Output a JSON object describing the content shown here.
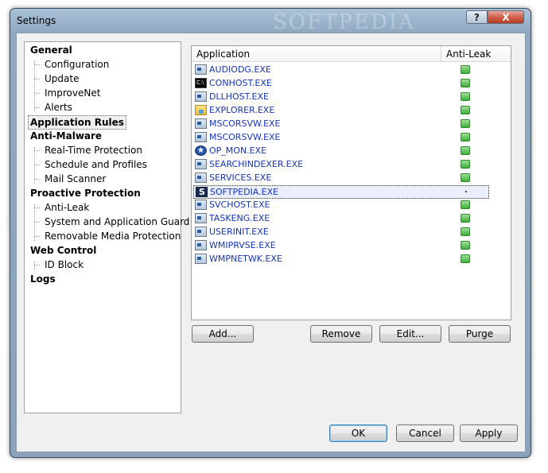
{
  "window": {
    "title": "Settings",
    "help_label": "?",
    "close_label": "X",
    "watermark": "SOFTPEDIA"
  },
  "tree": {
    "items": [
      {
        "label": "General",
        "level": 0
      },
      {
        "label": "Configuration",
        "level": 1
      },
      {
        "label": "Update",
        "level": 1
      },
      {
        "label": "ImproveNet",
        "level": 1
      },
      {
        "label": "Alerts",
        "level": 1
      },
      {
        "label": "Application Rules",
        "level": 0,
        "selected": true
      },
      {
        "label": "Anti-Malware",
        "level": 0
      },
      {
        "label": "Real-Time Protection",
        "level": 1
      },
      {
        "label": "Schedule and Profiles",
        "level": 1
      },
      {
        "label": "Mail Scanner",
        "level": 1
      },
      {
        "label": "Proactive Protection",
        "level": 0
      },
      {
        "label": "Anti-Leak",
        "level": 1
      },
      {
        "label": "System and Application Guard",
        "level": 1
      },
      {
        "label": "Removable Media Protection",
        "level": 1
      },
      {
        "label": "Web Control",
        "level": 0
      },
      {
        "label": "ID Block",
        "level": 1
      },
      {
        "label": "Logs",
        "level": 0
      }
    ]
  },
  "list": {
    "columns": {
      "application": "Application",
      "anti_leak": "Anti-Leak"
    },
    "rows": [
      {
        "name": "AUDIODG.EXE",
        "icon": "app-window-icon",
        "anti_leak": "enabled"
      },
      {
        "name": "CONHOST.EXE",
        "icon": "console-icon",
        "anti_leak": "enabled"
      },
      {
        "name": "DLLHOST.EXE",
        "icon": "app-window-icon",
        "anti_leak": "enabled"
      },
      {
        "name": "EXPLORER.EXE",
        "icon": "folder-icon",
        "anti_leak": "enabled"
      },
      {
        "name": "MSCORSVW.EXE",
        "icon": "app-window-icon",
        "anti_leak": "enabled"
      },
      {
        "name": "MSCORSVW.EXE",
        "icon": "app-window-icon",
        "anti_leak": "enabled"
      },
      {
        "name": "OP_MON.EXE",
        "icon": "star-icon",
        "anti_leak": "enabled"
      },
      {
        "name": "SEARCHINDEXER.EXE",
        "icon": "app-window-icon",
        "anti_leak": "enabled"
      },
      {
        "name": "SERVICES.EXE",
        "icon": "app-window-icon",
        "anti_leak": "enabled"
      },
      {
        "name": "SOFTPEDIA.EXE",
        "icon": "softpedia-icon",
        "anti_leak": "not set",
        "selected": true
      },
      {
        "name": "SVCHOST.EXE",
        "icon": "app-window-icon",
        "anti_leak": "enabled"
      },
      {
        "name": "TASKENG.EXE",
        "icon": "app-window-icon",
        "anti_leak": "enabled"
      },
      {
        "name": "USERINIT.EXE",
        "icon": "app-window-icon",
        "anti_leak": "enabled"
      },
      {
        "name": "WMIPRVSE.EXE",
        "icon": "app-window-icon",
        "anti_leak": "enabled"
      },
      {
        "name": "WMPNETWK.EXE",
        "icon": "app-window-icon",
        "anti_leak": "enabled"
      }
    ]
  },
  "buttons": {
    "add": "Add...",
    "remove": "Remove",
    "edit": "Edit...",
    "purge": "Purge",
    "ok": "OK",
    "cancel": "Cancel",
    "apply": "Apply"
  },
  "colors": {
    "link_blue": "#1535b5",
    "status_green": "#3fae3a",
    "frame_blue": "#90a9c0"
  }
}
